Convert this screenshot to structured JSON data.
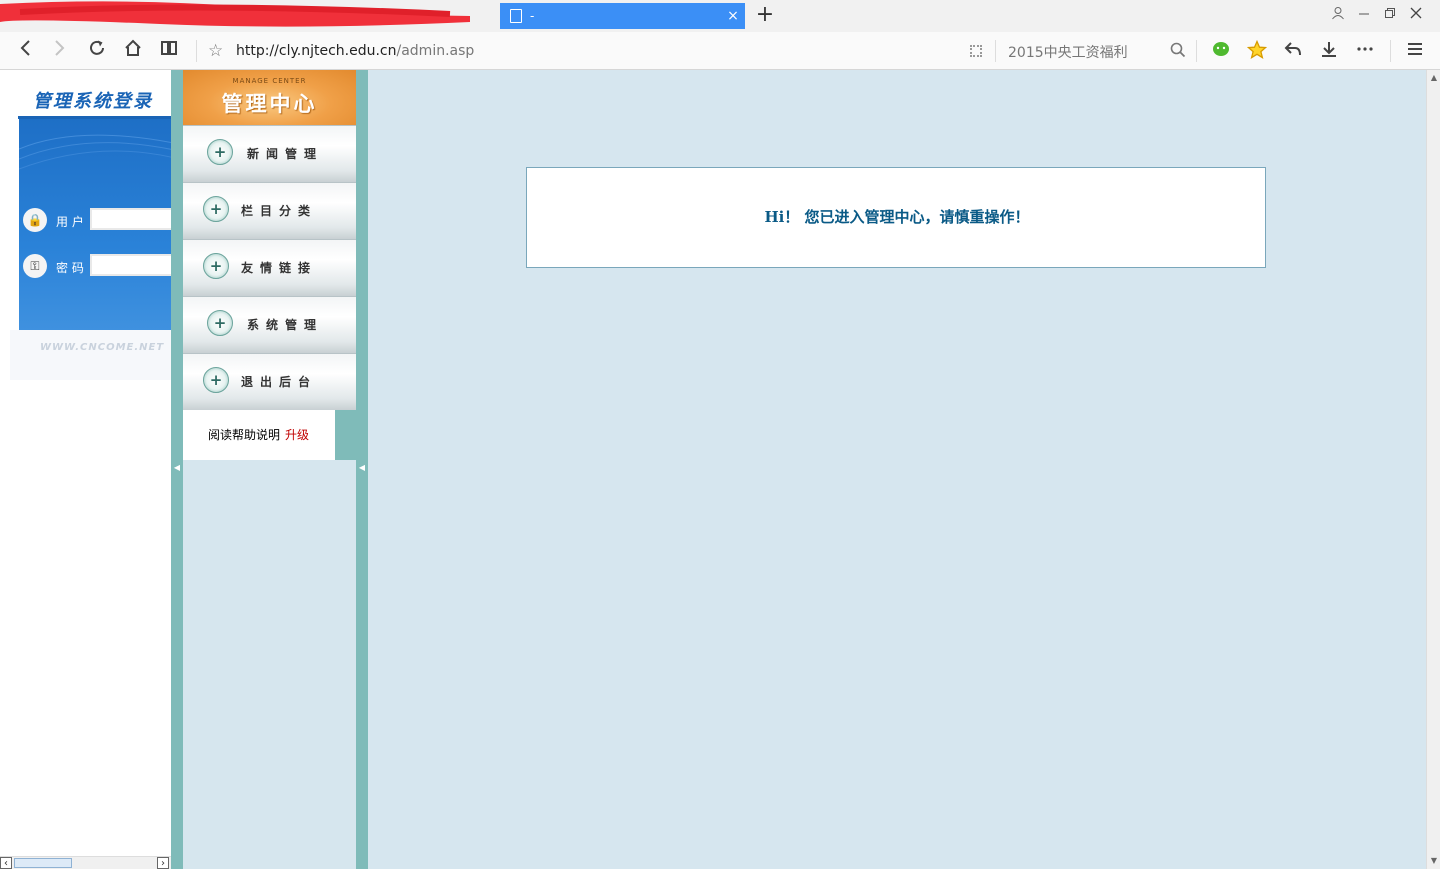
{
  "browser": {
    "tab_title": "-",
    "tab_close": "×",
    "new_tab": "+",
    "url_domain": "http://cly.njtech.edu.cn",
    "url_path": "/admin.asp",
    "search_text": "2015中央工资福利",
    "window_controls": [
      "user-icon",
      "minimize-icon",
      "restore-icon",
      "close-icon"
    ]
  },
  "login": {
    "title": "管理系统登录",
    "user_label": "用 户",
    "password_label": "密 码",
    "user_value": "",
    "password_value": "",
    "footer": "WWW.CNCOME.NET"
  },
  "menu": {
    "header_en": "MANAGE CENTER",
    "header_cn": "管理中心",
    "items": [
      {
        "label": "新闻管理"
      },
      {
        "label": "栏目分类"
      },
      {
        "label": "友情链接"
      },
      {
        "label": "系统管理"
      },
      {
        "label": "退出后台"
      }
    ],
    "help_label": "阅读帮助说明",
    "upgrade_label": "升级"
  },
  "main": {
    "welcome": "Hi！ 您已进入管理中心，请慎重操作！"
  },
  "colors": {
    "tab_active": "#3b8ff6",
    "splitter": "#7fbbb9",
    "main_bg": "#d6e6ef",
    "welcome_text": "#0a5a86",
    "upgrade": "#c00000"
  }
}
